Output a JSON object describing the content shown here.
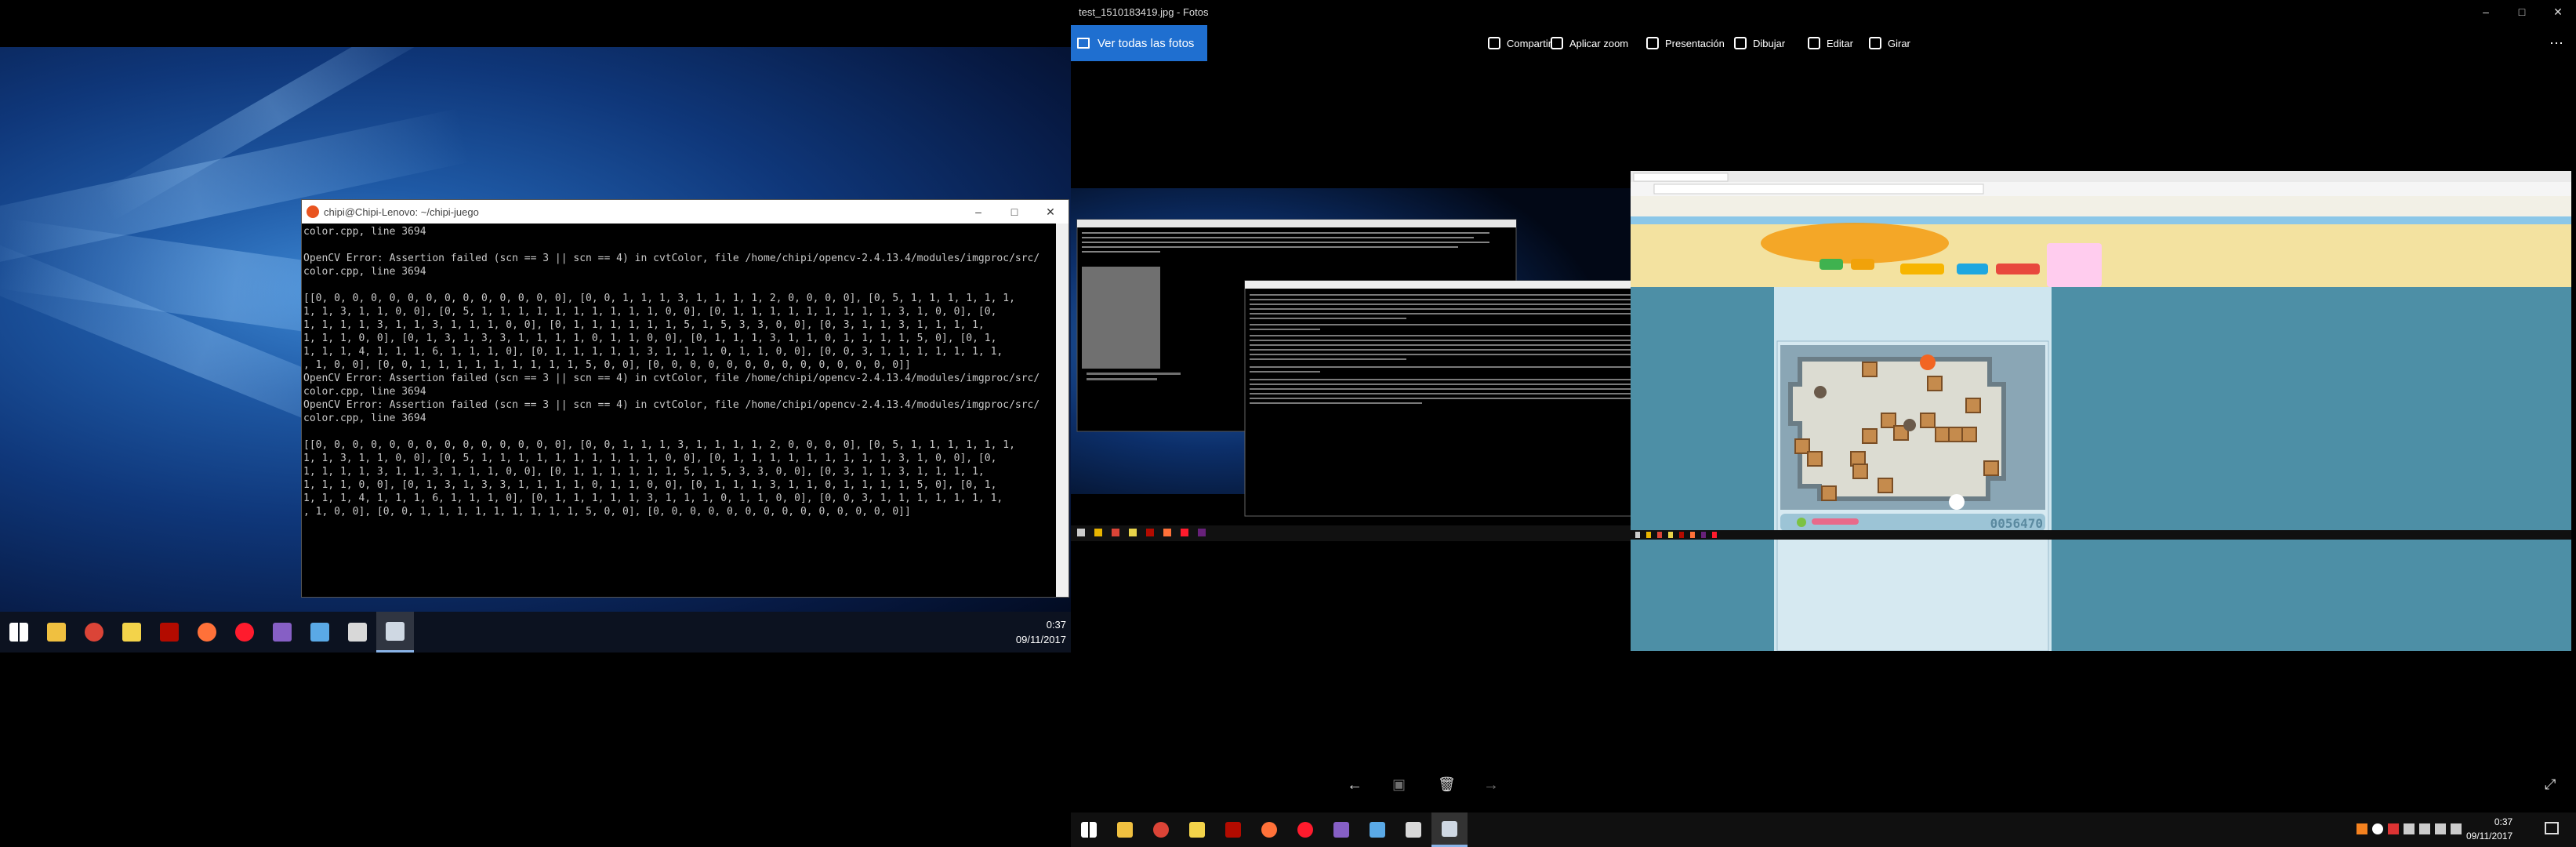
{
  "left_desktop": {
    "terminal": {
      "title": "chipi@Chipi-Lenovo: ~/chipi-juego",
      "lines": [
        "color.cpp, line 3694",
        "",
        "OpenCV Error: Assertion failed (scn == 3 || scn == 4) in cvtColor, file /home/chipi/opencv-2.4.13.4/modules/imgproc/src/",
        "color.cpp, line 3694",
        "",
        "[[0, 0, 0, 0, 0, 0, 0, 0, 0, 0, 0, 0, 0, 0], [0, 0, 1, 1, 1, 3, 1, 1, 1, 1, 2, 0, 0, 0, 0], [0, 5, 1, 1, 1, 1, 1, 1,",
        "1, 1, 3, 1, 1, 0, 0], [0, 5, 1, 1, 1, 1, 1, 1, 1, 1, 1, 1, 0, 0], [0, 1, 1, 1, 1, 1, 1, 1, 1, 1, 3, 1, 0, 0], [0,",
        "1, 1, 1, 1, 3, 1, 1, 3, 1, 1, 1, 0, 0], [0, 1, 1, 1, 1, 1, 1, 5, 1, 5, 3, 3, 0, 0], [0, 3, 1, 1, 3, 1, 1, 1, 1,",
        "1, 1, 1, 0, 0], [0, 1, 3, 1, 3, 3, 1, 1, 1, 1, 0, 1, 1, 0, 0], [0, 1, 1, 1, 3, 1, 1, 0, 1, 1, 1, 1, 5, 0], [0, 1,",
        "1, 1, 1, 4, 1, 1, 1, 6, 1, 1, 1, 0], [0, 1, 1, 1, 1, 1, 3, 1, 1, 1, 0, 1, 1, 0, 0], [0, 0, 3, 1, 1, 1, 1, 1, 1, 1,",
        ", 1, 0, 0], [0, 0, 1, 1, 1, 1, 1, 1, 1, 1, 1, 5, 0, 0], [0, 0, 0, 0, 0, 0, 0, 0, 0, 0, 0, 0, 0, 0]]",
        "OpenCV Error: Assertion failed (scn == 3 || scn == 4) in cvtColor, file /home/chipi/opencv-2.4.13.4/modules/imgproc/src/",
        "color.cpp, line 3694",
        "OpenCV Error: Assertion failed (scn == 3 || scn == 4) in cvtColor, file /home/chipi/opencv-2.4.13.4/modules/imgproc/src/",
        "color.cpp, line 3694",
        "",
        "[[0, 0, 0, 0, 0, 0, 0, 0, 0, 0, 0, 0, 0, 0], [0, 0, 1, 1, 1, 3, 1, 1, 1, 1, 2, 0, 0, 0, 0], [0, 5, 1, 1, 1, 1, 1, 1,",
        "1, 1, 3, 1, 1, 0, 0], [0, 5, 1, 1, 1, 1, 1, 1, 1, 1, 1, 1, 0, 0], [0, 1, 1, 1, 1, 1, 1, 1, 1, 1, 3, 1, 0, 0], [0,",
        "1, 1, 1, 1, 3, 1, 1, 3, 1, 1, 1, 0, 0], [0, 1, 1, 1, 1, 1, 1, 5, 1, 5, 3, 3, 0, 0], [0, 3, 1, 1, 3, 1, 1, 1, 1,",
        "1, 1, 1, 0, 0], [0, 1, 3, 1, 3, 3, 1, 1, 1, 1, 0, 1, 1, 0, 0], [0, 1, 1, 1, 3, 1, 1, 0, 1, 1, 1, 1, 5, 0], [0, 1,",
        "1, 1, 1, 4, 1, 1, 1, 6, 1, 1, 1, 0], [0, 1, 1, 1, 1, 1, 3, 1, 1, 1, 0, 1, 1, 0, 0], [0, 0, 3, 1, 1, 1, 1, 1, 1, 1,",
        ", 1, 0, 0], [0, 0, 1, 1, 1, 1, 1, 1, 1, 1, 1, 5, 0, 0], [0, 0, 0, 0, 0, 0, 0, 0, 0, 0, 0, 0, 0, 0]]"
      ]
    },
    "clock": {
      "time": "0:37",
      "date": "09/11/2017"
    },
    "taskbar_icons": [
      "windows-start-icon",
      "file-explorer-icon",
      "chrome-icon",
      "sticky-notes-icon",
      "acrobat-icon",
      "firefox-icon",
      "opera-icon",
      "visual-studio-icon",
      "notepad-icon",
      "terminal-icon",
      "photos-icon"
    ]
  },
  "photos_app": {
    "title": "test_1510183419.jpg - Fotos",
    "view_all": "Ver todas las fotos",
    "commands": [
      {
        "label": "Compartir",
        "icon": "share-icon"
      },
      {
        "label": "Aplicar zoom",
        "icon": "zoom-icon"
      },
      {
        "label": "Presentación",
        "icon": "slideshow-icon"
      },
      {
        "label": "Dibujar",
        "icon": "draw-icon"
      },
      {
        "label": "Editar",
        "icon": "edit-icon"
      },
      {
        "label": "Girar",
        "icon": "rotate-icon"
      }
    ],
    "more": "⋯",
    "clock": {
      "time": "0:37",
      "date": "09/11/2017"
    },
    "game_score": "0056470"
  },
  "colors": {
    "accent": "#1f6fd0",
    "terminal_bg": "#000000"
  }
}
